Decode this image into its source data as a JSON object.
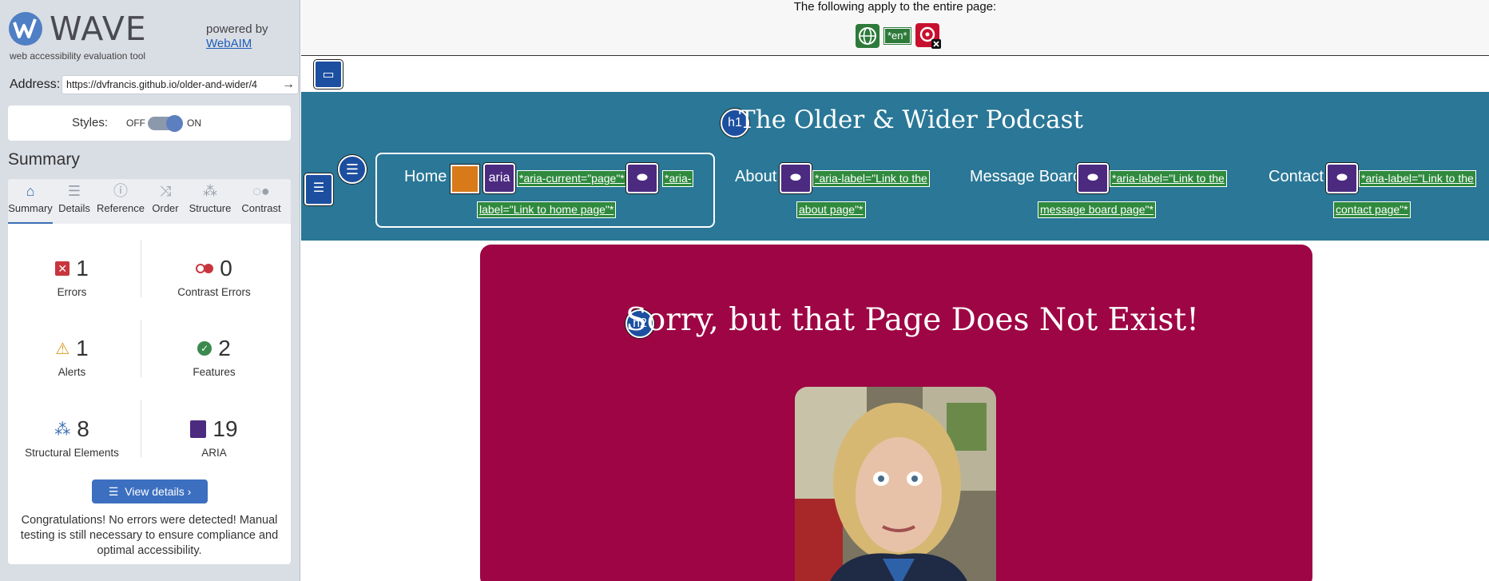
{
  "sidebar": {
    "logo_text": "WAVE",
    "logo_tagline": "web accessibility evaluation tool",
    "powered_by": "powered by",
    "powered_link": "WebAIM",
    "address_label": "Address:",
    "address_value": "https://dvfrancis.github.io/older-and-wider/4",
    "styles_label": "Styles:",
    "styles_off": "OFF",
    "styles_on": "ON",
    "summary_heading": "Summary",
    "tabs": [
      {
        "label": "Summary",
        "icon": "home-icon"
      },
      {
        "label": "Details",
        "icon": "list-icon"
      },
      {
        "label": "Reference",
        "icon": "info-icon"
      },
      {
        "label": "Order",
        "icon": "order-icon"
      },
      {
        "label": "Structure",
        "icon": "structure-icon"
      },
      {
        "label": "Contrast",
        "icon": "contrast-icon"
      }
    ],
    "stats": {
      "errors": {
        "count": "1",
        "label": "Errors"
      },
      "contrast_errors": {
        "count": "0",
        "label": "Contrast Errors"
      },
      "alerts": {
        "count": "1",
        "label": "Alerts"
      },
      "features": {
        "count": "2",
        "label": "Features"
      },
      "structural": {
        "count": "8",
        "label": "Structural Elements"
      },
      "aria": {
        "count": "19",
        "label": "ARIA"
      }
    },
    "view_details": "View details ›",
    "congrats": "Congratulations! No errors were detected! Manual testing is still necessary to ensure compliance and optimal accessibility."
  },
  "main": {
    "topbar_text": "The following apply to the entire page:",
    "lang_tag": "*en*",
    "site_title": "The Older & Wider Podcast",
    "h1_badge": "h1",
    "h2_badge": "h2",
    "aria_badge": "aria",
    "nav": {
      "home": "Home",
      "about": "About",
      "message_board": "Message Board",
      "contact": "Contact",
      "home_current": "*aria-current=\"page\"*",
      "home_label_1": "*aria-",
      "home_label_2": "label=\"Link to home page\"*",
      "about_label_1": "*aria-label=\"Link to the",
      "about_label_2": "about page\"*",
      "mb_label_1": "*aria-label=\"Link to the",
      "mb_label_2": "message board page\"*",
      "contact_label_1": "*aria-label=\"Link to the",
      "contact_label_2": "contact page\"*"
    },
    "page_heading": "Sorry, but that Page Does Not Exist!"
  },
  "colors": {
    "header_bg": "#2a7797",
    "card_bg": "#9e0544",
    "wave_blue": "#3c6fc0",
    "aria_green": "#2f8a3e",
    "aria_purple": "#4b2a80"
  }
}
